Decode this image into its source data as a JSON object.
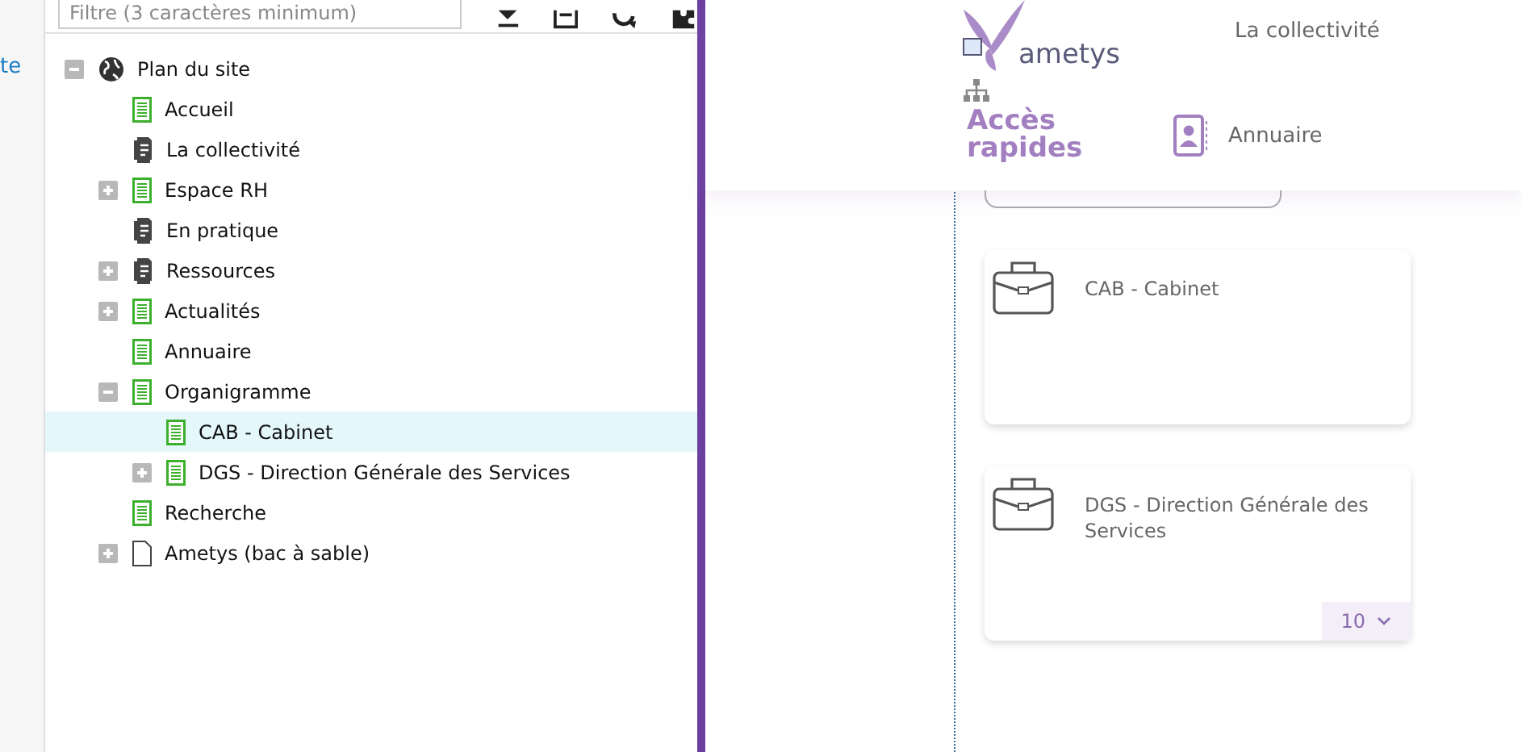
{
  "left_strip": {
    "link": "te"
  },
  "toolbar": {
    "filter": {
      "placeholder": "Filtre (3 caractères minimum)"
    }
  },
  "tree": [
    {
      "label": "Plan du site",
      "kind": "site",
      "expanded": true,
      "selected": false,
      "children": [
        {
          "label": "Accueil",
          "kind": "page",
          "selected": false
        },
        {
          "label": "La collectivité",
          "kind": "stack",
          "selected": false
        },
        {
          "label": "Espace RH",
          "kind": "page",
          "expanded": false,
          "selected": false
        },
        {
          "label": "En pratique",
          "kind": "stack",
          "selected": false
        },
        {
          "label": "Ressources",
          "kind": "stack",
          "expanded": false,
          "selected": false
        },
        {
          "label": "Actualités",
          "kind": "page",
          "expanded": false,
          "selected": false
        },
        {
          "label": "Annuaire",
          "kind": "page",
          "selected": false
        },
        {
          "label": "Organigramme",
          "kind": "page",
          "expanded": true,
          "selected": false,
          "children": [
            {
              "label": "CAB - Cabinet",
              "kind": "page",
              "selected": true
            },
            {
              "label": "DGS - Direction Générale des Services",
              "kind": "page",
              "expanded": false,
              "selected": false
            }
          ]
        },
        {
          "label": "Recherche",
          "kind": "page",
          "selected": false
        },
        {
          "label": "Ametys (bac à sable)",
          "kind": "blank",
          "expanded": false,
          "selected": false
        }
      ]
    }
  ],
  "site": {
    "logo": "ametys",
    "nav": "La collectivité",
    "quick_access": "Accès rapides",
    "directory": "Annuaire",
    "cards": [
      {
        "title": "CAB - Cabinet"
      },
      {
        "title": "DGS - Direction Générale des Services",
        "count": "10"
      }
    ]
  }
}
